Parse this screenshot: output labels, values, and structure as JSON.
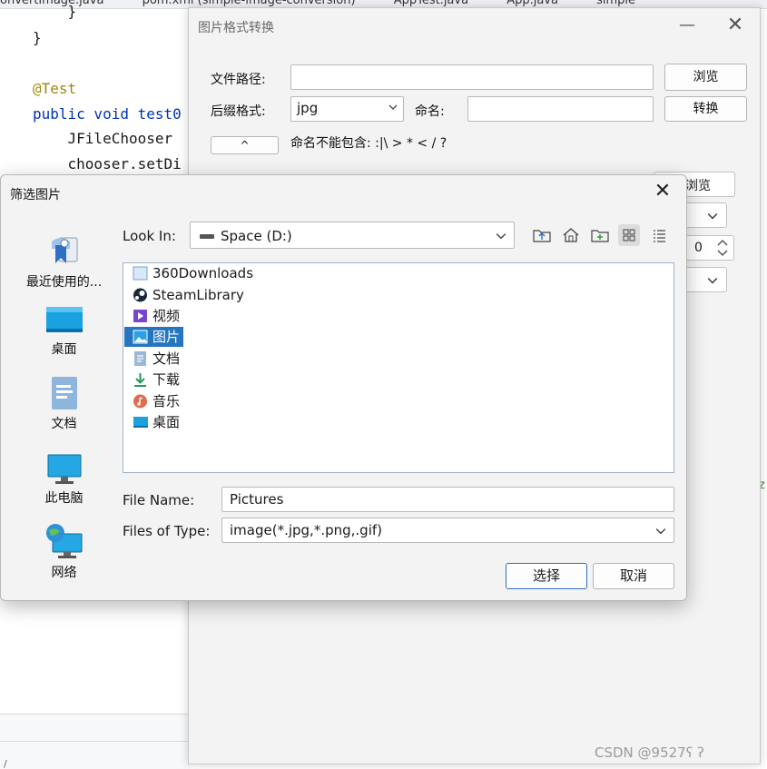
{
  "ide": {
    "tabs": [
      "onvertImage.java",
      "pom.xml (simple-image-conversion)",
      "AppTest.java",
      "App.java",
      "simple"
    ],
    "code": {
      "brace1": "    }",
      "brace2": "}",
      "annotation": "@Test",
      "method": "public void test0",
      "line_chooser": "    JFileChooser",
      "line_setdir": "    chooser.setDi"
    },
    "side_letter": "z",
    "status_text": "/"
  },
  "convert_window": {
    "title": "图片格式转换",
    "minimize_glyph": "—",
    "close_glyph": "✕",
    "file_path_label": "文件路径:",
    "file_path_value": "",
    "browse_label": "浏览",
    "suffix_label": "后缀格式:",
    "suffix_value": "jpg",
    "name_label": "命名:",
    "name_value": "",
    "convert_label": "转换",
    "toggle_label": "^",
    "hint": "命名不能包含: :|\\ > * < / ?",
    "browse2_label": "浏览",
    "spinner_value": "0"
  },
  "file_chooser": {
    "title": "筛选图片",
    "close_glyph": "✕",
    "places": [
      {
        "label": "最近使用的...",
        "icon": "recent-items-icon"
      },
      {
        "label": "桌面",
        "icon": "desktop-icon"
      },
      {
        "label": "文档",
        "icon": "documents-icon"
      },
      {
        "label": "此电脑",
        "icon": "this-pc-icon"
      },
      {
        "label": "网络",
        "icon": "network-icon"
      }
    ],
    "look_in_label": "Look In:",
    "look_in_value": "Space (D:)",
    "files": [
      {
        "name": "360Downloads",
        "icon": "folder-icon"
      },
      {
        "name": "SteamLibrary",
        "icon": "steam-icon"
      },
      {
        "name": "视频",
        "icon": "video-folder-icon"
      },
      {
        "name": "图片",
        "icon": "pictures-folder-icon"
      },
      {
        "name": "文档",
        "icon": "documents-folder-icon"
      },
      {
        "name": "下载",
        "icon": "downloads-folder-icon"
      },
      {
        "name": "音乐",
        "icon": "music-folder-icon"
      },
      {
        "name": "桌面",
        "icon": "desktop-folder-icon"
      }
    ],
    "selected_file": "图片",
    "file_name_label": "File Name:",
    "file_name_value": "Pictures",
    "file_type_label": "Files of Type:",
    "file_type_value": "image(*.jpg,*.png,.gif)",
    "ok_label": "选择",
    "cancel_label": "取消"
  },
  "watermark": "CSDN @9527ʕ  ʔ",
  "colors": {
    "selection": "#2675bf",
    "ok_border": "#2c6fc0",
    "annotation": "#9e880d",
    "keyword": "#0033b3"
  }
}
